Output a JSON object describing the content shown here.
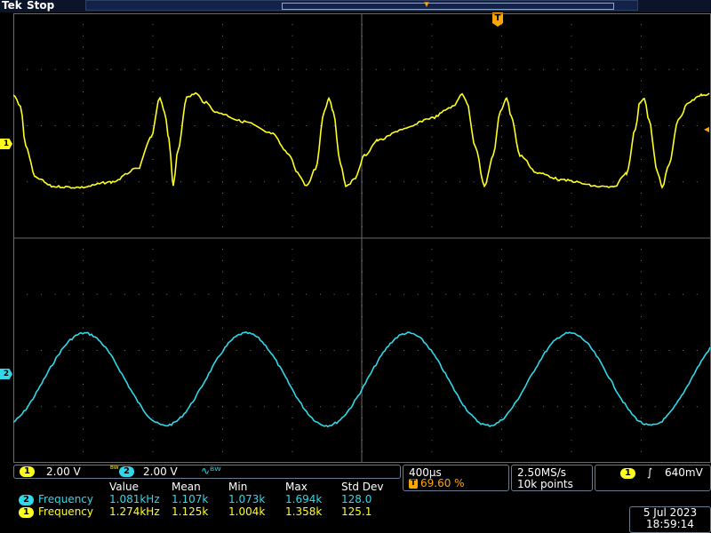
{
  "top": {
    "brand": "Tek",
    "status": "Stop",
    "trigger_marker": "T"
  },
  "channels": {
    "ch1": {
      "number": "1",
      "scale": "2.00 V",
      "color": "#ffff20"
    },
    "ch2": {
      "number": "2",
      "scale": "2.00 V",
      "color": "#30d8e8"
    }
  },
  "horizontal": {
    "time_per_div": "400µs",
    "trigger_position": "69.60 %"
  },
  "acquisition": {
    "sample_rate": "2.50MS/s",
    "record_length": "10k points"
  },
  "trigger": {
    "source": "1",
    "slope_icon": "rising-edge-icon",
    "level": "640mV"
  },
  "measurements": {
    "headers": [
      "Value",
      "Mean",
      "Min",
      "Max",
      "Std Dev"
    ],
    "rows": [
      {
        "channel": "2",
        "name": "Frequency",
        "value": "1.081kHz",
        "mean": "1.107k",
        "min": "1.073k",
        "max": "1.694k",
        "std": "128.0"
      },
      {
        "channel": "1",
        "name": "Frequency",
        "value": "1.274kHz",
        "mean": "1.125k",
        "min": "1.004k",
        "max": "1.358k",
        "std": "125.1"
      }
    ]
  },
  "datetime": {
    "date": "5 Jul  2023",
    "time": "18:59:14"
  }
}
